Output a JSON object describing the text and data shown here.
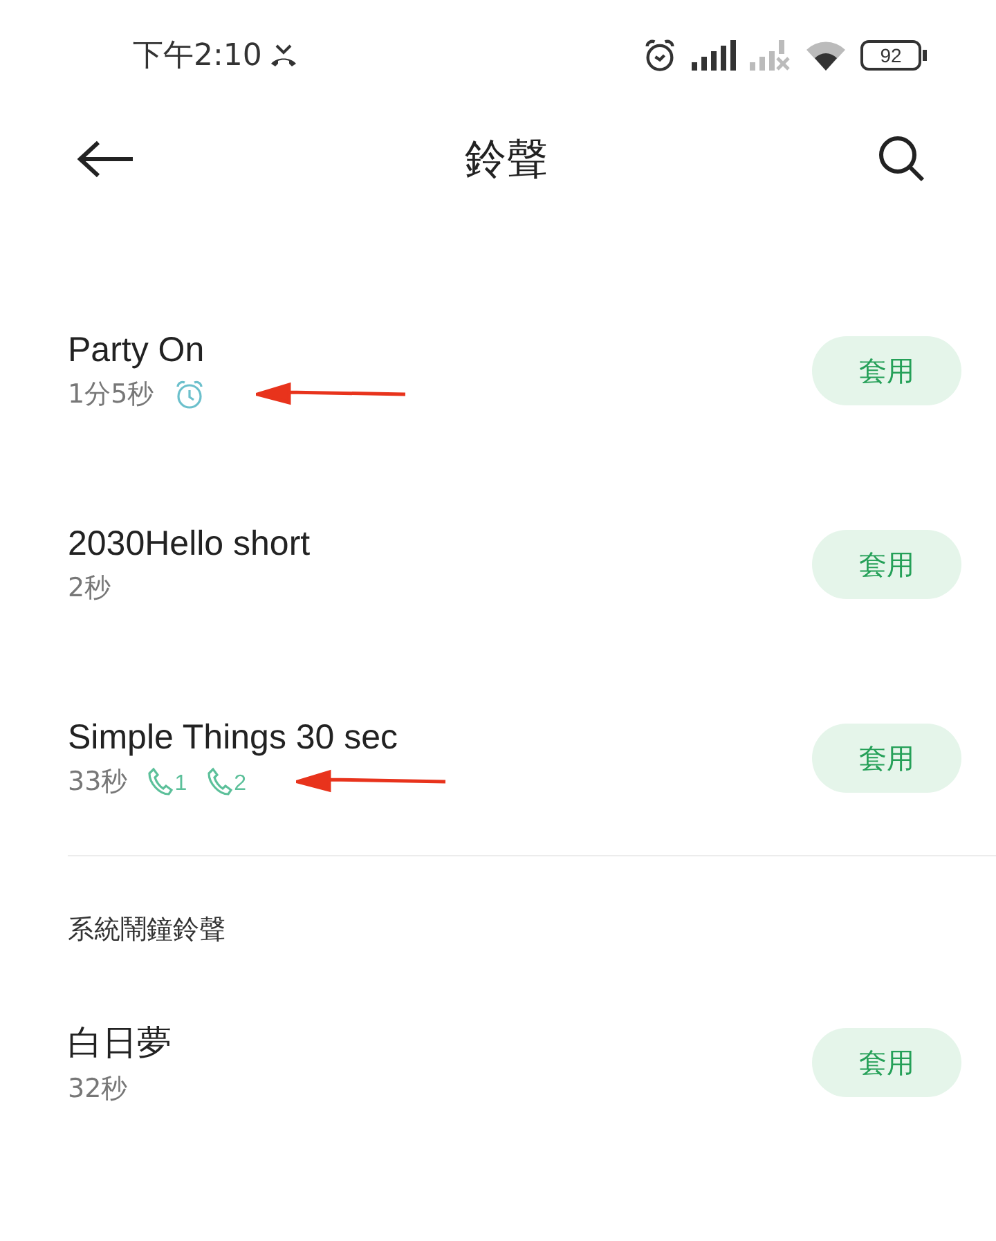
{
  "status_bar": {
    "time": "下午2:10",
    "battery": "92"
  },
  "header": {
    "title": "鈴聲"
  },
  "ringtones": [
    {
      "title": "Party On",
      "duration": "1分5秒",
      "tags": [
        {
          "kind": "alarm"
        }
      ],
      "marked": true,
      "button": "套用"
    },
    {
      "title": "2030Hello short",
      "duration": "2秒",
      "marked": false,
      "button": "套用"
    },
    {
      "title": "Simple Things 30 sec",
      "duration": "33秒",
      "tags": [
        {
          "kind": "call",
          "sim": "1"
        },
        {
          "kind": "call",
          "sim": "2"
        }
      ],
      "marked": true,
      "button": "套用"
    }
  ],
  "system_section": {
    "heading": "系統鬧鐘鈴聲",
    "items": [
      {
        "title": "白日夢",
        "duration": "32秒",
        "marked": false,
        "button": "套用"
      }
    ]
  }
}
